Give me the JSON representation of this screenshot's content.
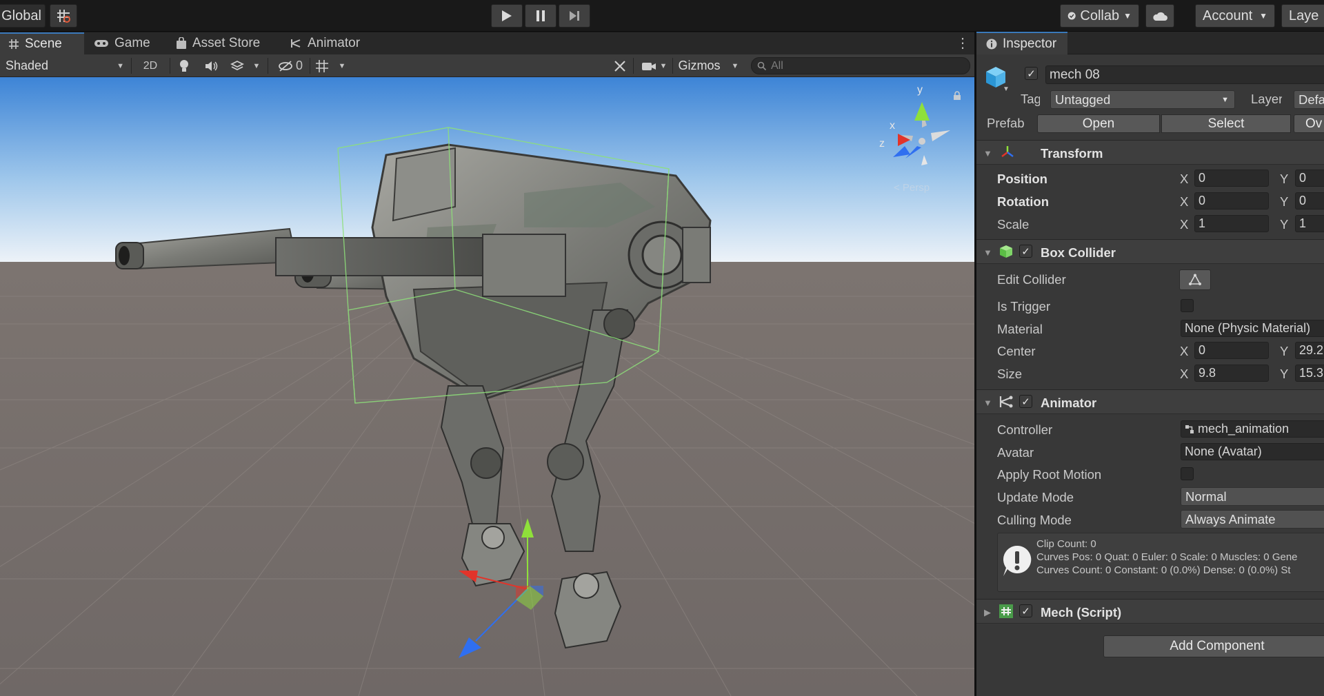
{
  "topbar": {
    "global_label": "Global",
    "collab_label": "Collab",
    "account_label": "Account",
    "layers_label": "Laye"
  },
  "tabs": [
    {
      "label": "Scene",
      "icon": "grid-hash-icon"
    },
    {
      "label": "Game",
      "icon": "gamepad-icon"
    },
    {
      "label": "Asset Store",
      "icon": "shopping-bag-icon"
    },
    {
      "label": "Animator",
      "icon": "animator-node-icon"
    }
  ],
  "scene_toolbar": {
    "shading_mode": "Shaded",
    "mode_2d": "2D",
    "hidden_count": "0",
    "gizmos_label": "Gizmos",
    "search_placeholder": "All"
  },
  "gizmo_axes": {
    "y": "y",
    "x": "x",
    "z": "z",
    "view": "< Persp"
  },
  "inspector": {
    "tab_label": "Inspector",
    "object_name": "mech 08",
    "tag_label": "Tag",
    "tag_value": "Untagged",
    "layer_label": "Layer",
    "layer_value": "Default",
    "prefab_label": "Prefab",
    "prefab_open": "Open",
    "prefab_select": "Select",
    "prefab_overrides": "Ov",
    "transform": {
      "title": "Transform",
      "position_label": "Position",
      "rotation_label": "Rotation",
      "scale_label": "Scale",
      "position": {
        "x": "0",
        "y": "0"
      },
      "rotation": {
        "x": "0",
        "y": "0"
      },
      "scale": {
        "x": "1",
        "y": "1"
      }
    },
    "box_collider": {
      "title": "Box Collider",
      "edit_label": "Edit Collider",
      "trigger_label": "Is Trigger",
      "material_label": "Material",
      "material_value": "None (Physic Material)",
      "center_label": "Center",
      "center": {
        "x": "0",
        "y": "29.2"
      },
      "size_label": "Size",
      "size": {
        "x": "9.8",
        "y": "15.3"
      }
    },
    "animator": {
      "title": "Animator",
      "controller_label": "Controller",
      "controller_value": "mech_animation",
      "avatar_label": "Avatar",
      "avatar_value": "None (Avatar)",
      "root_motion_label": "Apply Root Motion",
      "update_mode_label": "Update Mode",
      "update_mode_value": "Normal",
      "culling_mode_label": "Culling Mode",
      "culling_mode_value": "Always Animate",
      "info_line1": "Clip Count: 0",
      "info_line2": "Curves Pos: 0 Quat: 0 Euler: 0 Scale: 0 Muscles: 0 Gene",
      "info_line3": "Curves Count: 0 Constant: 0 (0.0%) Dense: 0 (0.0%) St"
    },
    "mech_script": {
      "title": "Mech (Script)"
    },
    "add_component": "Add Component",
    "axis_x": "X",
    "axis_y": "Y"
  },
  "colors": {
    "accent_tab": "#3a79bb",
    "axis_x": "#e2342a",
    "axis_y": "#8fe03a",
    "axis_z": "#2f6ff0",
    "collider_green": "#8ee07a"
  }
}
